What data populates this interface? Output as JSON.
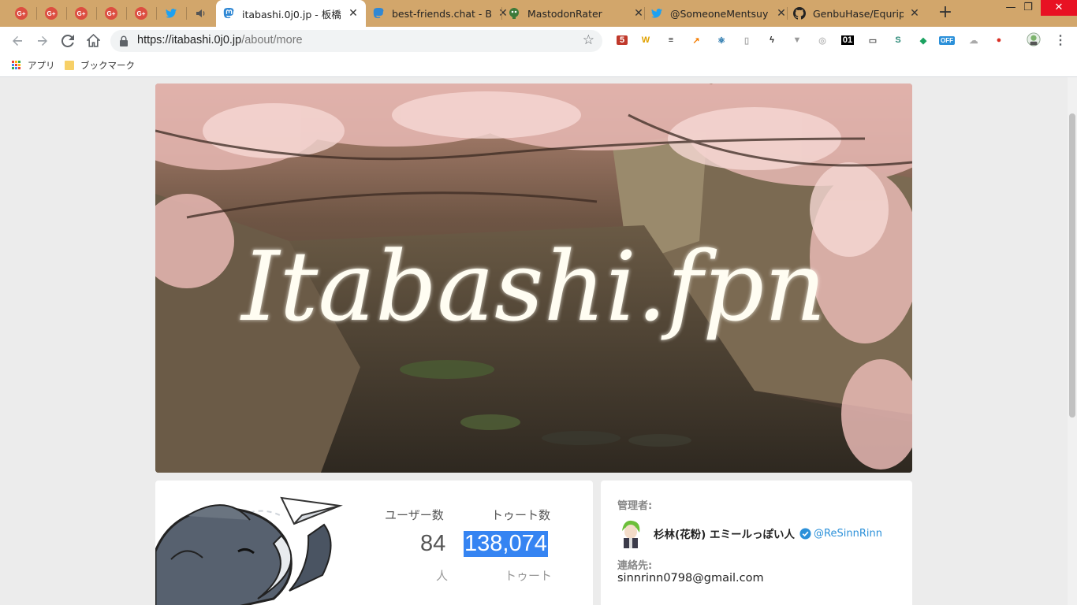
{
  "browser": {
    "tabs": [
      {
        "title": "",
        "icon": "google-plus-icon",
        "pinned": true
      },
      {
        "title": "",
        "icon": "google-plus-icon",
        "pinned": true
      },
      {
        "title": "",
        "icon": "google-plus-icon",
        "pinned": true
      },
      {
        "title": "",
        "icon": "google-plus-icon",
        "pinned": true
      },
      {
        "title": "",
        "icon": "google-plus-icon",
        "pinned": true
      },
      {
        "title": "",
        "icon": "twitter-icon",
        "pinned": true
      },
      {
        "title": "",
        "icon": "speaker-icon",
        "pinned": true
      },
      {
        "title": "itabashi.0j0.jp - 板橋",
        "icon": "mastodon-icon",
        "active": true
      },
      {
        "title": "best-friends.chat - B",
        "icon": "mastodon-icon"
      },
      {
        "title": "MastodonRater",
        "icon": "mastodon-rater-icon"
      },
      {
        "title": "@SomeoneMentsuy",
        "icon": "twitter-icon"
      },
      {
        "title": "GenbuHase/Equript",
        "icon": "github-icon"
      }
    ],
    "tab_close_glyph": "✕",
    "gplus_text": "G+",
    "new_tab_glyph": "+",
    "window": {
      "minimize": "—",
      "restore": "❐",
      "close": "✕"
    },
    "address": {
      "host": "https://itabashi.0j0.jp",
      "path": "/about/more"
    },
    "extensions": [
      {
        "name": "tab-counter-extension",
        "text": "5",
        "color": "#c0392b"
      },
      {
        "name": "w-extension",
        "text": "W",
        "color": "#e0a100"
      },
      {
        "name": "buffer-extension",
        "text": "≡",
        "color": "#222222"
      },
      {
        "name": "chart-extension",
        "text": "↗",
        "color": "#f57c00"
      },
      {
        "name": "react-devtools-extension",
        "text": "⚛",
        "color": "#1a6fa8"
      },
      {
        "name": "page-extension",
        "text": "▯",
        "color": "#aaaaaa"
      },
      {
        "name": "bolt-extension",
        "text": "ϟ",
        "color": "#222222"
      },
      {
        "name": "vue-devtools-extension",
        "text": "▼",
        "color": "#999999"
      },
      {
        "name": "face-extension",
        "text": "◎",
        "color": "#bbbbbb"
      },
      {
        "name": "01-extension",
        "text": "01",
        "color": "#000000"
      },
      {
        "name": "line-extension",
        "text": "▭",
        "color": "#555555"
      },
      {
        "name": "s-extension",
        "text": "S",
        "color": "#2e8b7a"
      },
      {
        "name": "shield-extension",
        "text": "◆",
        "color": "#1aa260"
      },
      {
        "name": "mastodon-off-extension",
        "text": "OFF",
        "color": "#2b90d9"
      },
      {
        "name": "cloud-extension",
        "text": "☁",
        "color": "#aaaaaa"
      },
      {
        "name": "record-extension",
        "text": "●",
        "color": "#d93025"
      }
    ],
    "bookmarks": [
      {
        "label": "アプリ",
        "icon": "apps-grid-icon"
      },
      {
        "label": "ブックマーク",
        "icon": "folder-icon"
      }
    ]
  },
  "hero": {
    "banner_text": "Itabashi.fpn"
  },
  "stats": {
    "users_label": "ユーザー数",
    "users_value": "84",
    "users_unit": "人",
    "toots_label": "トゥート数",
    "toots_value": "138,074",
    "toots_unit": "トゥート"
  },
  "admin": {
    "label": "管理者:",
    "name": "杉林(花粉) エミールっぽい人",
    "handle": "@ReSinnRinn",
    "contact_label": "連絡先:",
    "email": "sinnrinn0798@gmail.com"
  },
  "colors": {
    "tabstrip": "#d2a66b",
    "highlight": "#3584f2",
    "link": "#2b90d9"
  }
}
